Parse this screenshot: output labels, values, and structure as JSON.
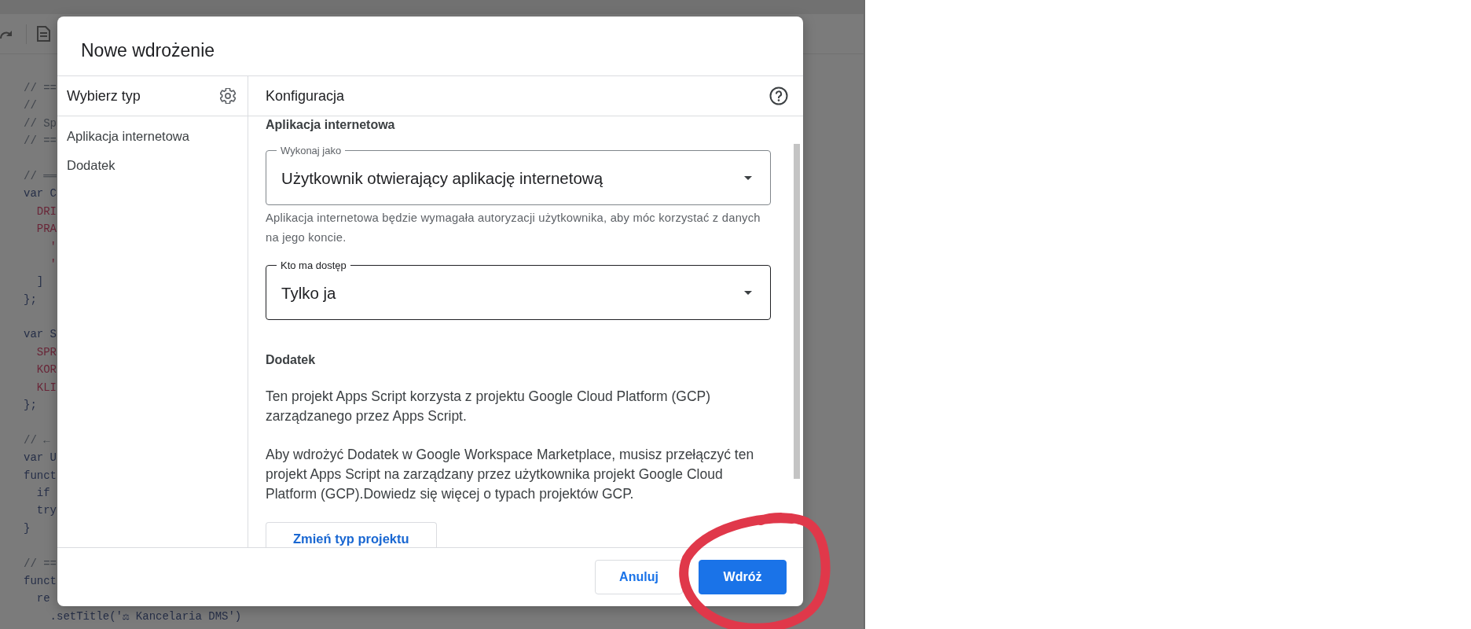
{
  "editor": {
    "code_blocks": [
      [
        {
          "text": "// ==",
          "kind": "comment"
        },
        {
          "text": "//",
          "kind": "comment"
        },
        {
          "text": "// Sp",
          "kind": "comment"
        },
        {
          "text": "// ==",
          "kind": "comment"
        }
      ],
      [
        {
          "text": "// ══",
          "kind": "comment"
        },
        {
          "text": "var C",
          "kind": "code"
        },
        {
          "text": "  DRI",
          "kind": "constant"
        },
        {
          "text": "  PRA",
          "kind": "constant"
        },
        {
          "text": "    '",
          "kind": "string"
        },
        {
          "text": "    '",
          "kind": "string"
        },
        {
          "text": "  ]",
          "kind": "code"
        },
        {
          "text": "};",
          "kind": "code"
        }
      ],
      [
        {
          "text": "var S",
          "kind": "code"
        },
        {
          "text": "  SPR",
          "kind": "constant"
        },
        {
          "text": "  KOR",
          "kind": "constant"
        },
        {
          "text": "  KLI",
          "kind": "constant"
        },
        {
          "text": "};",
          "kind": "code"
        }
      ],
      [
        {
          "text": "// ←",
          "kind": "comment"
        },
        {
          "text": "var U",
          "kind": "code"
        },
        {
          "text": "funct",
          "kind": "code"
        },
        {
          "text": "  if",
          "kind": "code"
        },
        {
          "text": "  try",
          "kind": "code"
        },
        {
          "text": "}",
          "kind": "code"
        }
      ],
      [
        {
          "text": "// ==",
          "kind": "comment"
        },
        {
          "text": "funct",
          "kind": "code"
        },
        {
          "text": "  re",
          "kind": "code"
        },
        {
          "text": "    .setTitle('⚖ Kancelaria DMS')",
          "kind": "code"
        }
      ]
    ]
  },
  "dialog": {
    "title": "Nowe wdrożenie",
    "type_panel": {
      "heading": "Wybierz typ",
      "items": [
        {
          "label": "Aplikacja internetowa",
          "selected": false
        },
        {
          "label": "Dodatek",
          "selected": false
        }
      ]
    },
    "config_panel": {
      "heading": "Konfiguracja",
      "web_app_section": {
        "heading": "Aplikacja internetowa",
        "fields": [
          {
            "label": "Wykonaj jako",
            "value": "Użytkownik otwierający aplikację internetową",
            "focused": false,
            "hint": "Aplikacja internetowa będzie wymagała autoryzacji użytkownika, aby móc korzystać z danych na jego koncie."
          },
          {
            "label": "Kto ma dostęp",
            "value": "Tylko ja",
            "focused": true
          }
        ]
      },
      "addon_section": {
        "heading": "Dodatek",
        "paragraphs": [
          {
            "text": "Ten projekt Apps Script korzysta z projektu Google Cloud Platform (GCP) zarządzanego przez Apps Script."
          },
          {
            "text": "Aby wdrożyć Dodatek w Google Workspace Marketplace, musisz przełączyć ten projekt Apps Script na zarządzany przez użytkownika projekt Google Cloud Platform (GCP).",
            "link": "Dowiedz się więcej",
            "text_after": " o typach projektów GCP."
          }
        ],
        "button": "Zmień typ projektu"
      }
    },
    "buttons": [
      {
        "label": "Anuluj",
        "kind": "secondary",
        "circled": false
      },
      {
        "label": "Wdróż",
        "kind": "primary",
        "circled": true
      }
    ]
  }
}
